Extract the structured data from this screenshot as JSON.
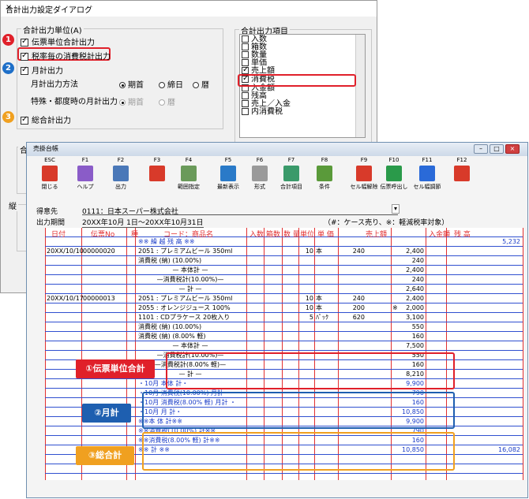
{
  "dialog": {
    "title": "合計出力設定ダイアログ",
    "close": "×",
    "unit_group": "合計出力単位(A)",
    "denpyo": "伝票単位合計出力",
    "zeiritsu": "税率毎の消費税計出力",
    "getsu": "月計出力",
    "getsu_method": "月計出力方法",
    "radio_kikan": "期首",
    "radio_shime": "締日",
    "radio_koyomi": "暦",
    "tokurei": "特殊・都度時の月計出力",
    "total": "総合計出力",
    "items_group": "合計出力項目",
    "items": [
      "入数",
      "箱数",
      "数量",
      "単価",
      "売上額",
      "消費税",
      "入金額",
      "残高",
      "売上／入金",
      "内消費税"
    ],
    "badges": [
      "1",
      "2",
      "3"
    ],
    "back_group2_label": "合",
    "back_group3_label": "縦"
  },
  "window": {
    "title": "売掛台帳",
    "buttons": [
      {
        "key": "ESC",
        "label": "閉じる",
        "color": "#d83a2a"
      },
      {
        "key": "F1",
        "label": "ヘルプ",
        "color": "#8a5cc8"
      },
      {
        "key": "F2",
        "label": "出力",
        "color": "#4a78b8"
      },
      {
        "key": "F3",
        "label": "",
        "color": "#d83a2a"
      },
      {
        "key": "F4",
        "label": "範囲指定",
        "color": "#6a9a5a"
      },
      {
        "key": "F5",
        "label": "最新表示",
        "color": "#2a7ac8"
      },
      {
        "key": "F6",
        "label": "形式",
        "color": "#9a9a9a"
      },
      {
        "key": "F7",
        "label": "合計項目",
        "color": "#3a9a6a"
      },
      {
        "key": "F8",
        "label": "条件",
        "color": "#5a9a3a"
      },
      {
        "key": "F9",
        "label": "セル幅解除",
        "color": "#d83a2a"
      },
      {
        "key": "F10",
        "label": "伝票呼出し",
        "color": "#2a9a4a"
      },
      {
        "key": "F11",
        "label": "セル幅調節",
        "color": "#2a6ad8"
      },
      {
        "key": "F12",
        "label": "",
        "color": "#d83a2a"
      }
    ],
    "customer_label": "得意先",
    "customer_value": "0111：日本スーパー株式会社",
    "period_label": "出力期間",
    "period_value": "20XX年10月 1日〜20XX年10月31日",
    "note": "（#：ケース売り、※：軽減税率対象）"
  },
  "grid": {
    "headers": [
      "日付",
      "伝票No",
      "種",
      "コード：商品名",
      "入数",
      "箱数",
      "数 量",
      "単位",
      "単 価",
      "売上額",
      "入金額",
      "残 高"
    ],
    "rows": [
      {
        "name": "※※ 繰 越 残 高 ※※",
        "blue": true,
        "balance": "5,232"
      },
      {
        "date": "20XX/10/10",
        "no": "00000020",
        "name": "2051 : プレミアムビール 350ml",
        "qty": "10",
        "unit": "本",
        "price": "240",
        "sales": "2,400"
      },
      {
        "name": "消費税 (納) (10.00%)",
        "sales": "240"
      },
      {
        "name": "— 本体計 —",
        "center": true,
        "sales": "2,400"
      },
      {
        "name": "—消費税計(10.00%)—",
        "center": true,
        "sales": "240"
      },
      {
        "name": "— 計 —",
        "center": true,
        "sales": "2,640"
      },
      {
        "date": "20XX/10/17",
        "no": "00000013",
        "name": "2051 : プレミアムビール 350ml",
        "qty": "10",
        "unit": "本",
        "price": "240",
        "sales": "2,400"
      },
      {
        "name": "2055 : オレンジジュース 100%",
        "qty": "10",
        "unit": "本",
        "price": "200",
        "mark": "※",
        "sales": "2,000"
      },
      {
        "name": "1101 : CDプラケース 20枚入り",
        "qty": "5",
        "unit": "ﾊﾟｯｸ",
        "price": "620",
        "sales": "3,100"
      },
      {
        "name": "消費税 (納) (10.00%)",
        "sales": "550"
      },
      {
        "name": "消費税 (納) (8.00% 軽)",
        "sales": "160"
      },
      {
        "name": "— 本体計 —",
        "center": true,
        "sales": "7,500"
      },
      {
        "name": "—消費税計(10.00%)—",
        "center": true,
        "sales": "550"
      },
      {
        "name": "—消費税計(8.00% 軽)—",
        "center": true,
        "sales": "160"
      },
      {
        "name": "— 計 —",
        "center": true,
        "sales": "8,210"
      },
      {
        "name": "・10月 本体 計・",
        "blue": true,
        "sales": "9,900"
      },
      {
        "name": "・10月 消費税(10.00%) 月計 ・",
        "blue": true,
        "sales": "790"
      },
      {
        "name": "・10月 消費税(8.00% 軽) 月計 ・",
        "blue": true,
        "sales": "160"
      },
      {
        "name": "・10月 月 計・",
        "blue": true,
        "sales": "10,850"
      },
      {
        "name": "※※本 体 計※※",
        "blue": true,
        "sales": "9,900"
      },
      {
        "name": "※※消費税(10.00%) 計※※",
        "blue": true,
        "sales": "790"
      },
      {
        "name": "※※消費税(8.00% 軽) 計※※",
        "blue": true,
        "sales": "160"
      },
      {
        "name": "※※ 計 ※※",
        "blue": true,
        "sales": "10,850",
        "balance": "16,082"
      }
    ]
  },
  "callouts": {
    "c1": "①伝票単位合計",
    "c2": "②月計",
    "c3": "③総合計",
    "red": "#e0202a",
    "blue": "#1e5fb0",
    "orange": "#f0a020"
  }
}
